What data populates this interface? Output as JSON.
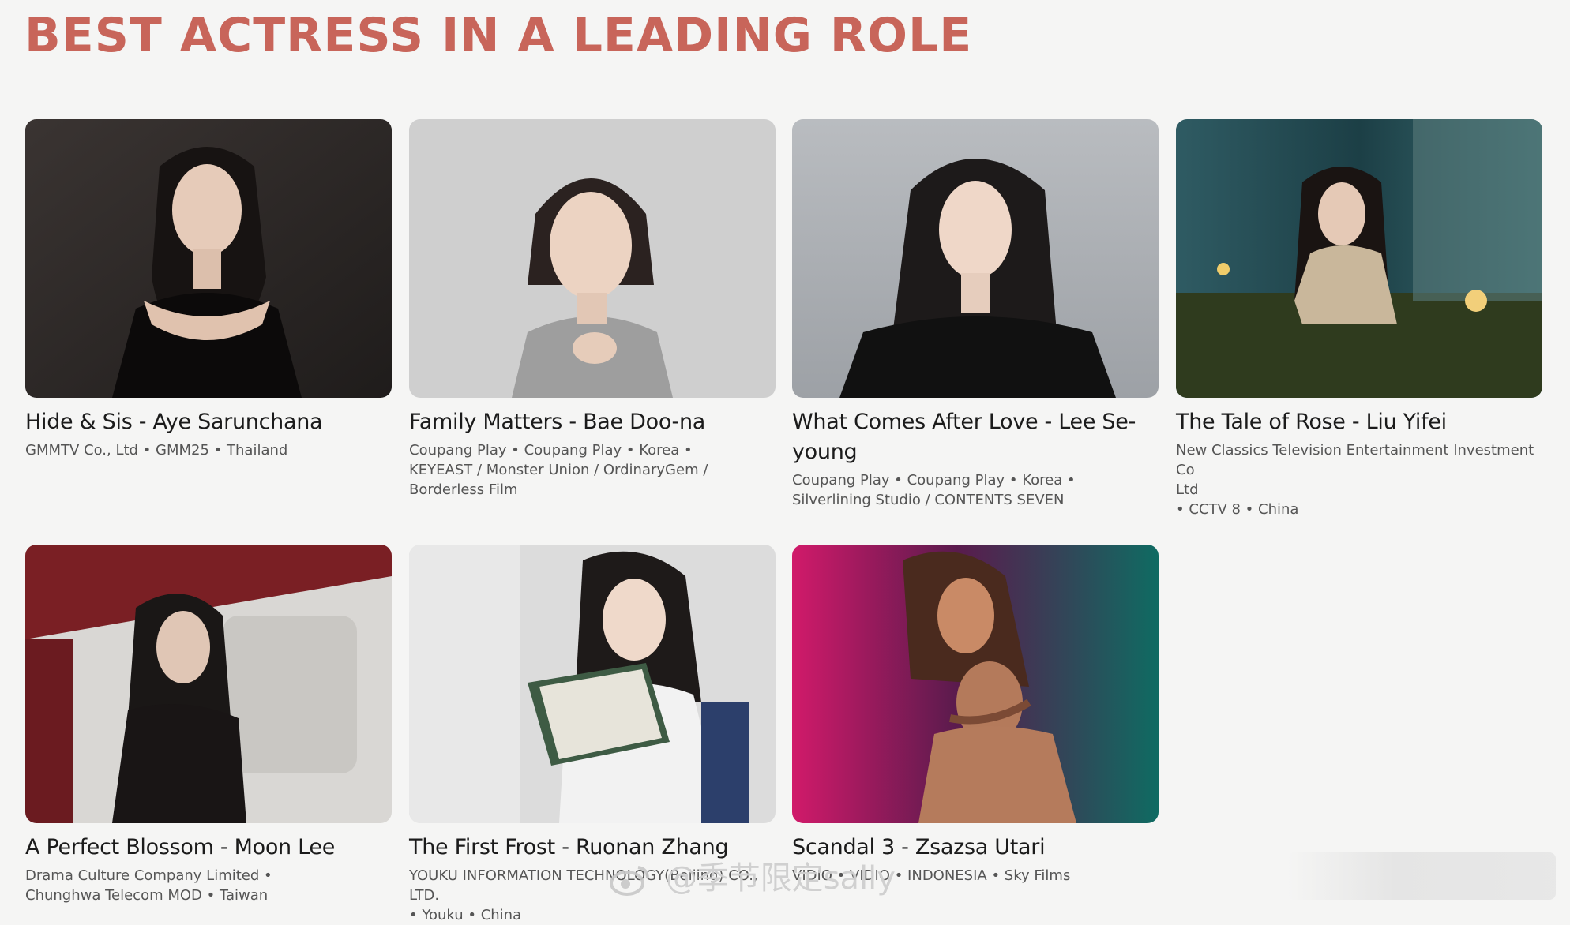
{
  "page": {
    "title": "BEST ACTRESS IN A LEADING ROLE"
  },
  "nominees": [
    {
      "title": "Hide & Sis - Aye Sarunchana",
      "meta_lines": [
        "GMMTV Co., Ltd • GMM25 • Thailand"
      ]
    },
    {
      "title": "Family Matters - Bae Doo-na",
      "meta_lines": [
        "Coupang Play • Coupang Play • Korea •",
        "KEYEAST / Monster Union / OrdinaryGem /",
        "Borderless Film"
      ]
    },
    {
      "title": "What Comes After Love - Lee Se-",
      "title2": "young",
      "meta_lines": [
        "Coupang Play • Coupang Play • Korea •",
        "Silverlining Studio / CONTENTS SEVEN"
      ]
    },
    {
      "title": "The Tale of Rose - Liu Yifei",
      "meta_lines": [
        "New Classics Television Entertainment Investment Co",
        "Ltd",
        "• CCTV 8 • China"
      ]
    },
    {
      "title": "A Perfect Blossom - Moon Lee",
      "meta_lines": [
        "Drama Culture Company Limited •",
        "Chunghwa Telecom MOD • Taiwan"
      ]
    },
    {
      "title": "The First Frost - Ruonan Zhang",
      "meta_lines": [
        "YOUKU INFORMATION TECHNOLOGY(Beijing) CO.,",
        "LTD.",
        "• Youku • China"
      ]
    },
    {
      "title": "Scandal 3 - Zsazsa Utari",
      "meta_lines": [
        "VIDIO • VIDIO • INDONESIA • Sky Films"
      ]
    }
  ],
  "watermark": {
    "text": "@季节限定sally",
    "icon": "weibo-logo-icon"
  },
  "colors": {
    "title": "#c8655a",
    "background": "#f5f5f4"
  }
}
